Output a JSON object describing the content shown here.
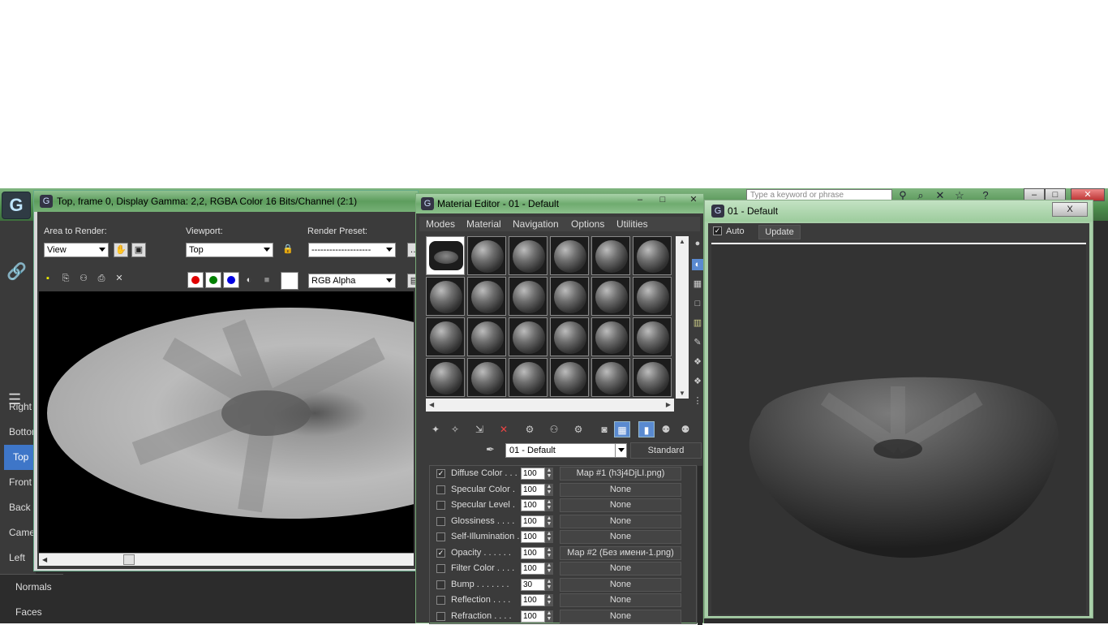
{
  "app": {
    "logo_glyph": "G",
    "search_placeholder": "Type a keyword or phrase",
    "viewports": [
      "Right",
      "Bottom",
      "Top",
      "Front",
      "Back",
      "Camera",
      "Left"
    ],
    "active_viewport": "Top",
    "bottom_items": [
      "Normals",
      "Faces"
    ],
    "accent_color": "#3e76c8"
  },
  "render_window": {
    "title": "Top, frame 0, Display Gamma: 2,2, RGBA Color 16 Bits/Channel (2:1)",
    "area_label": "Area to Render:",
    "area_value": "View",
    "viewport_label": "Viewport:",
    "viewport_value": "Top",
    "preset_label": "Render Preset:",
    "preset_value": "--------------------",
    "channel_value": "RGB Alpha",
    "channel_colors": {
      "red": "#e00000",
      "green": "#008000",
      "blue": "#0000e0"
    }
  },
  "material_editor": {
    "title": "Material Editor - 01 - Default",
    "menu": [
      "Modes",
      "Material",
      "Navigation",
      "Options",
      "Utilities"
    ],
    "material_name": "01 - Default",
    "material_type": "Standard",
    "maps": [
      {
        "checked": true,
        "name": "Diffuse Color . . .",
        "amount": "100",
        "map": "Map #1 (h3j4DjLI.png)"
      },
      {
        "checked": false,
        "name": "Specular Color  .",
        "amount": "100",
        "map": "None"
      },
      {
        "checked": false,
        "name": "Specular Level  .",
        "amount": "100",
        "map": "None"
      },
      {
        "checked": false,
        "name": "Glossiness  . . . .",
        "amount": "100",
        "map": "None"
      },
      {
        "checked": false,
        "name": "Self-Illumination .",
        "amount": "100",
        "map": "None"
      },
      {
        "checked": true,
        "name": "Opacity . . . . . .",
        "amount": "100",
        "map": "Map #2 (Без имени-1.png)"
      },
      {
        "checked": false,
        "name": "Filter Color  . . . .",
        "amount": "100",
        "map": "None"
      },
      {
        "checked": false,
        "name": "Bump  . . . . . . .",
        "amount": "30",
        "map": "None"
      },
      {
        "checked": false,
        "name": "Reflection  . . . .",
        "amount": "100",
        "map": "None"
      },
      {
        "checked": false,
        "name": "Refraction  . . . .",
        "amount": "100",
        "map": "None"
      }
    ]
  },
  "preview_window": {
    "title": "01 - Default",
    "auto_label": "Auto",
    "auto_checked": true,
    "update_label": "Update",
    "close_label": "X"
  }
}
